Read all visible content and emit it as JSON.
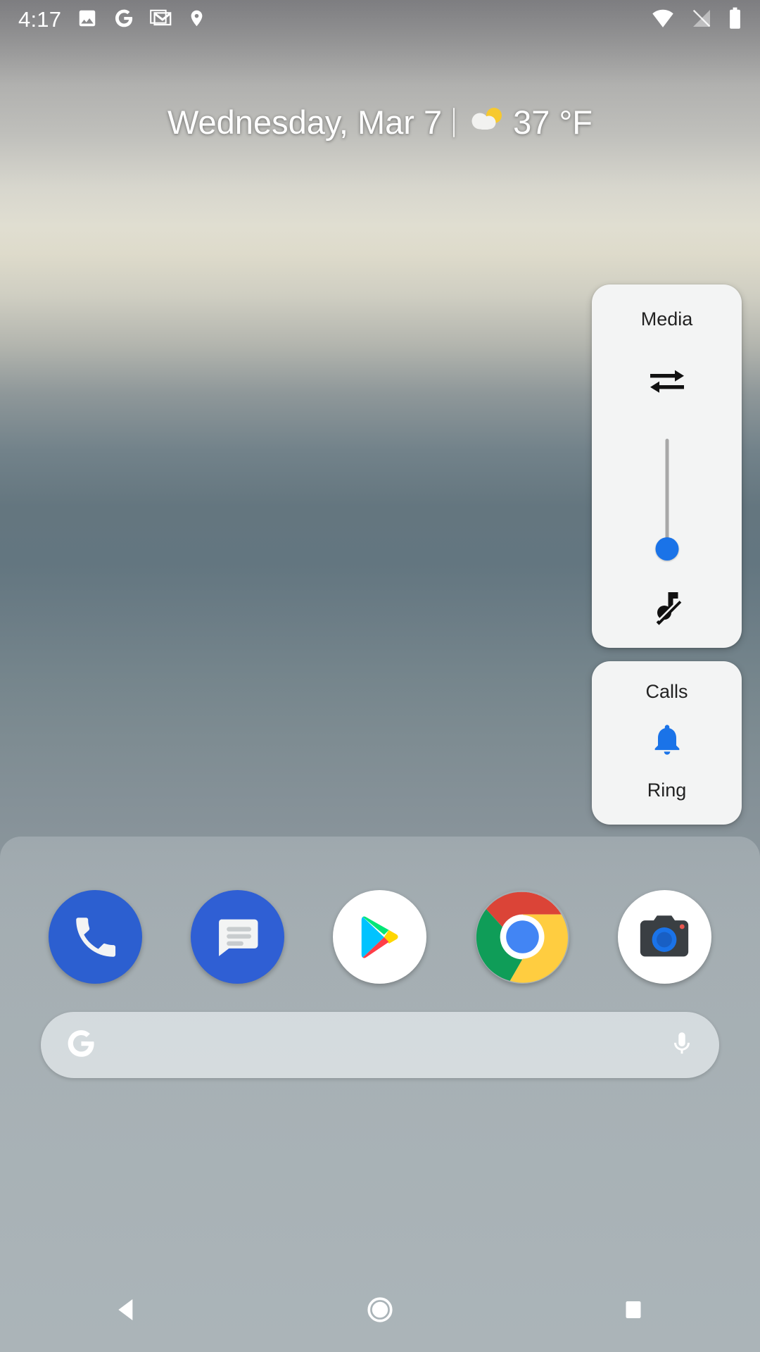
{
  "status_bar": {
    "clock": "4:17",
    "left_icons": [
      {
        "name": "photos-icon",
        "glyph": "image"
      },
      {
        "name": "google-icon",
        "glyph": "G"
      },
      {
        "name": "gmail-icon",
        "glyph": "envelope"
      },
      {
        "name": "location-pin-icon",
        "glyph": "pin"
      }
    ],
    "right_icons": [
      {
        "name": "wifi-icon",
        "glyph": "wifi-full"
      },
      {
        "name": "no-sim-signal-icon",
        "glyph": "signal-crossed"
      },
      {
        "name": "battery-icon",
        "glyph": "battery-full"
      }
    ]
  },
  "date_widget": {
    "date": "Wednesday, Mar 7",
    "separator": "|",
    "weather_icon": "partly-cloudy-icon",
    "temperature": "37 °F"
  },
  "volume_panel": {
    "media": {
      "title": "Media",
      "cast_icon": "swap-arrows-icon",
      "slider": {
        "name": "media-volume-slider",
        "orientation": "vertical",
        "value_percent": 0,
        "thumb_color": "#1a73e8",
        "track_color": "#a8a8a8"
      },
      "state_icon": "music-note-muted-icon"
    },
    "calls": {
      "title": "Calls",
      "icon": "bell-ring-icon",
      "icon_color": "#1a73e8",
      "state_label": "Ring"
    }
  },
  "dock": {
    "apps": [
      {
        "name": "phone-app-icon",
        "label": "Phone"
      },
      {
        "name": "messages-app-icon",
        "label": "Messages"
      },
      {
        "name": "play-store-app-icon",
        "label": "Play Store"
      },
      {
        "name": "chrome-app-icon",
        "label": "Chrome"
      },
      {
        "name": "camera-app-icon",
        "label": "Camera"
      }
    ]
  },
  "search_bar": {
    "logo_icon": "google-g-icon",
    "placeholder": "",
    "value": "",
    "mic_icon": "microphone-icon"
  },
  "nav_bar": {
    "back": "back-nav-icon",
    "home": "home-nav-icon",
    "recents": "recents-nav-icon"
  },
  "colors": {
    "accent_blue": "#1a73e8",
    "panel_bg": "#f3f4f4",
    "status_text": "#ffffff"
  }
}
